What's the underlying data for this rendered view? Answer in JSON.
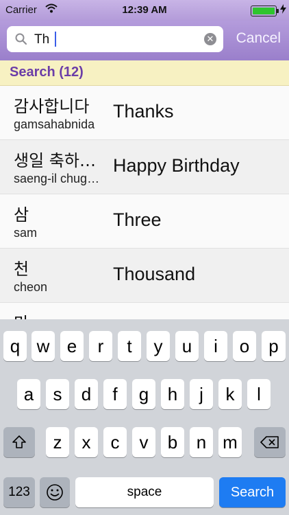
{
  "status_bar": {
    "carrier": "Carrier",
    "time": "12:39 AM"
  },
  "search": {
    "value": "Th",
    "cancel_label": "Cancel"
  },
  "section": {
    "title": "Search (12)"
  },
  "results": [
    {
      "korean": "감사합니다",
      "romanization": "gamsahabnida",
      "english": "Thanks"
    },
    {
      "korean": "생일 축하합니다",
      "romanization": "saeng-il chughahabnida",
      "english": "Happy Birthday"
    },
    {
      "korean": "삼",
      "romanization": "sam",
      "english": "Three"
    },
    {
      "korean": "천",
      "romanization": "cheon",
      "english": "Thousand"
    },
    {
      "korean": "만",
      "romanization": "",
      "english": ""
    }
  ],
  "keyboard": {
    "row1": [
      "q",
      "w",
      "e",
      "r",
      "t",
      "y",
      "u",
      "i",
      "o",
      "p"
    ],
    "row2": [
      "a",
      "s",
      "d",
      "f",
      "g",
      "h",
      "j",
      "k",
      "l"
    ],
    "row3": [
      "z",
      "x",
      "c",
      "v",
      "b",
      "n",
      "m"
    ],
    "numbers_label": "123",
    "space_label": "space",
    "search_label": "Search"
  },
  "colors": {
    "accent": "#6b3da8",
    "header": "#9a7fcb",
    "section_bg": "#f7f1c2",
    "search_key": "#1e7cf2"
  }
}
